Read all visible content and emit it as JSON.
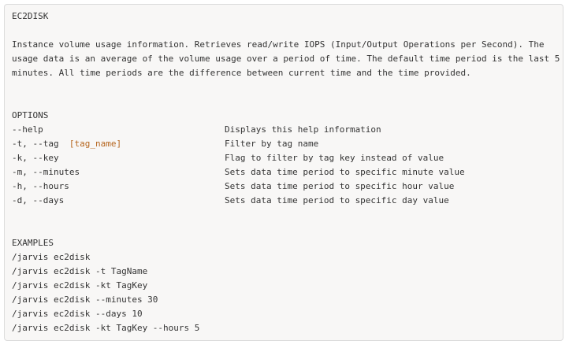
{
  "title": "EC2DISK",
  "description": [
    "Instance volume usage information. Retrieves read/write IOPS (Input/Output Operations per Second). The",
    "usage data is an average of the volume usage over a period of time. The default time period is the last 5",
    "minutes. All time periods are the difference between current time and the time provided."
  ],
  "options_heading": "OPTIONS",
  "options": [
    {
      "flag": "--help",
      "arg": "",
      "desc": "Displays this help information"
    },
    {
      "flag": "-t, --tag  ",
      "arg": "[tag_name]",
      "desc": "Filter by tag name"
    },
    {
      "flag": "-k, --key",
      "arg": "",
      "desc": "Flag to filter by tag key instead of value"
    },
    {
      "flag": "-m, --minutes",
      "arg": "",
      "desc": "Sets data time period to specific minute value"
    },
    {
      "flag": "-h, --hours",
      "arg": "",
      "desc": "Sets data time period to specific hour value"
    },
    {
      "flag": "-d, --days",
      "arg": "",
      "desc": "Sets data time period to specific day value"
    }
  ],
  "examples_heading": "EXAMPLES",
  "examples": [
    "/jarvis ec2disk",
    "/jarvis ec2disk -t TagName",
    "/jarvis ec2disk -kt TagKey",
    "/jarvis ec2disk --minutes 30",
    "/jarvis ec2disk --days 10",
    "/jarvis ec2disk -kt TagKey --hours 5"
  ]
}
